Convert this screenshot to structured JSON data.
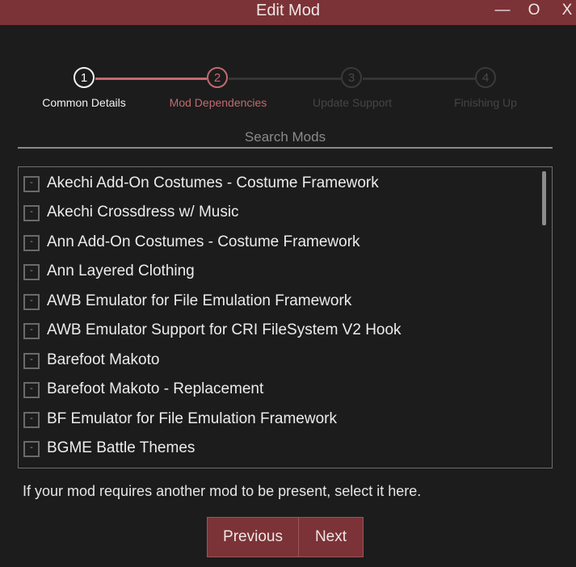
{
  "window": {
    "title": "Edit Mod",
    "minimize_label": "—",
    "maximize_label": "O",
    "close_label": "X"
  },
  "stepper": {
    "steps": [
      {
        "number": "1",
        "label": "Common Details",
        "state": "completed"
      },
      {
        "number": "2",
        "label": "Mod Dependencies",
        "state": "active"
      },
      {
        "number": "3",
        "label": "Update Support",
        "state": "pending"
      },
      {
        "number": "4",
        "label": "Finishing Up",
        "state": "pending"
      }
    ]
  },
  "search": {
    "placeholder": "Search Mods",
    "value": ""
  },
  "mods": [
    {
      "name": "Akechi Add-On Costumes - Costume Framework",
      "checkbox": "-"
    },
    {
      "name": "Akechi Crossdress w/ Music",
      "checkbox": "-"
    },
    {
      "name": "Ann Add-On Costumes - Costume Framework",
      "checkbox": "-"
    },
    {
      "name": "Ann Layered Clothing",
      "checkbox": "-"
    },
    {
      "name": "AWB Emulator for File Emulation Framework",
      "checkbox": "-"
    },
    {
      "name": "AWB Emulator Support for CRI FileSystem V2 Hook",
      "checkbox": "-"
    },
    {
      "name": "Barefoot Makoto",
      "checkbox": "-"
    },
    {
      "name": "Barefoot Makoto - Replacement",
      "checkbox": "-"
    },
    {
      "name": "BF Emulator for File Emulation Framework",
      "checkbox": "-"
    },
    {
      "name": "BGME Battle Themes",
      "checkbox": "-"
    }
  ],
  "help_text": "If your mod requires another mod to be present, select it here.",
  "buttons": {
    "previous": "Previous",
    "next": "Next"
  },
  "colors": {
    "accent": "#7b3337",
    "step_active": "#c26a6f",
    "background": "#1c1c1c"
  }
}
